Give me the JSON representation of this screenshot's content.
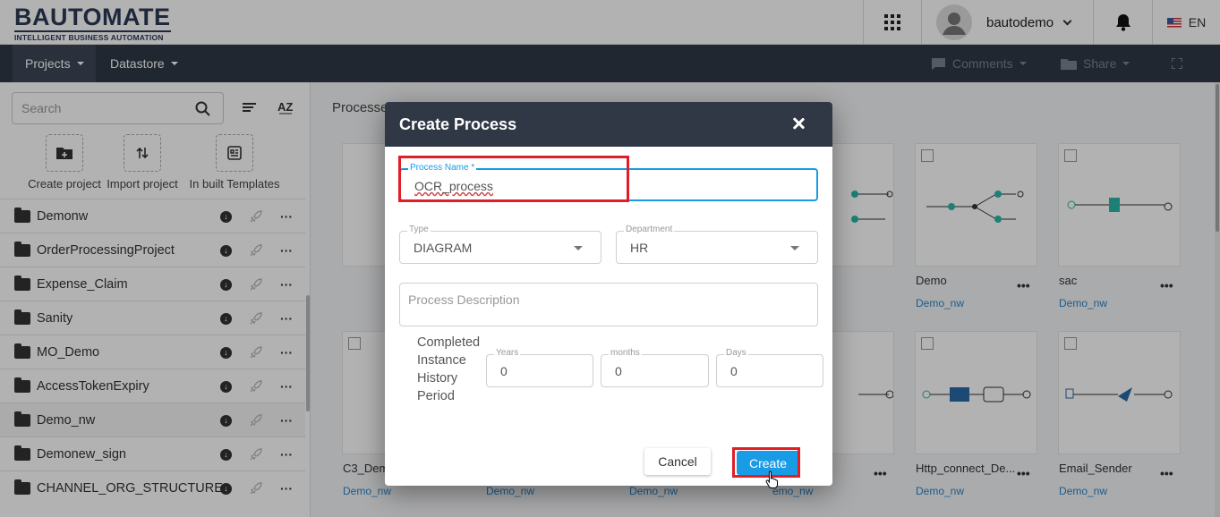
{
  "app": {
    "logo_main": "BAUTOMATE",
    "logo_sub": "INTELLIGENT BUSINESS AUTOMATION",
    "username": "bautodemo",
    "language": "EN"
  },
  "nav": {
    "projects": "Projects",
    "datastore": "Datastore",
    "comments": "Comments",
    "share": "Share"
  },
  "sidebar": {
    "search_placeholder": "Search",
    "actions": {
      "create": "Create project",
      "import": "Import project",
      "templates": "In built Templates"
    },
    "projects": [
      "Demonw",
      "OrderProcessingProject",
      "Expense_Claim",
      "Sanity",
      "MO_Demo",
      "AccessTokenExpiry",
      "Demo_nw",
      "Demonew_sign",
      "CHANNEL_ORG_STRUCTURE"
    ]
  },
  "main": {
    "processes_label": "Processe",
    "cards": [
      {
        "title": "Demo",
        "project": "Demo_nw"
      },
      {
        "title": "sac",
        "project": "Demo_nw"
      },
      {
        "title": "C3_Dem",
        "project": "Demo_nw"
      },
      {
        "title": "",
        "project": "Demo_nw"
      },
      {
        "title": "",
        "project": "Demo_nw"
      },
      {
        "title": "",
        "project": "emo_nw"
      },
      {
        "title": "Http_connect_De...",
        "project": "Demo_nw"
      },
      {
        "title": "Email_Sender",
        "project": "Demo_nw"
      }
    ]
  },
  "modal": {
    "title": "Create Process",
    "process_name_label": "Process Name *",
    "process_name_value": "OCR_process",
    "type_label": "Type",
    "type_value": "DIAGRAM",
    "department_label": "Department",
    "department_value": "HR",
    "description_placeholder": "Process Description",
    "history_label": "Completed Instance History Period",
    "years_label": "Years",
    "years_value": "0",
    "months_label": "months",
    "months_value": "0",
    "days_label": "Days",
    "days_value": "0",
    "cancel": "Cancel",
    "create": "Create"
  },
  "colors": {
    "header_dark": "#303846",
    "accent_blue": "#1a9be6",
    "highlight_red": "#e01e26",
    "link_blue": "#2a84c9"
  }
}
